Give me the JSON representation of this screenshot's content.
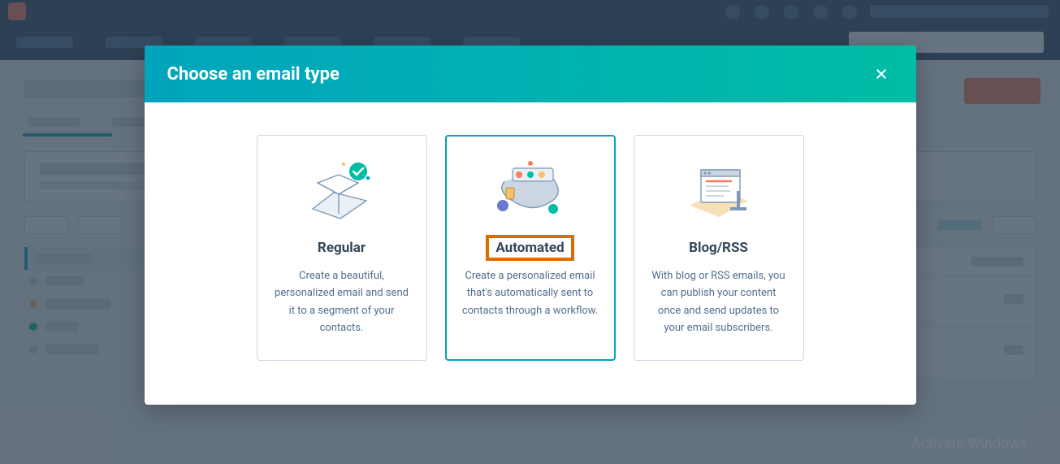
{
  "modal": {
    "title": "Choose an email type",
    "cards": {
      "regular": {
        "title": "Regular",
        "desc": "Create a beautiful, personalized email and send it to a segment of your contacts."
      },
      "automated": {
        "title": "Automated",
        "desc": "Create a personalized email that's automatically sent to contacts through a workflow."
      },
      "blogrss": {
        "title": "Blog/RSS",
        "desc": "With blog or RSS emails, you can publish your content once and send updates to your email subscribers."
      }
    }
  },
  "watermark": "Activate Windows"
}
